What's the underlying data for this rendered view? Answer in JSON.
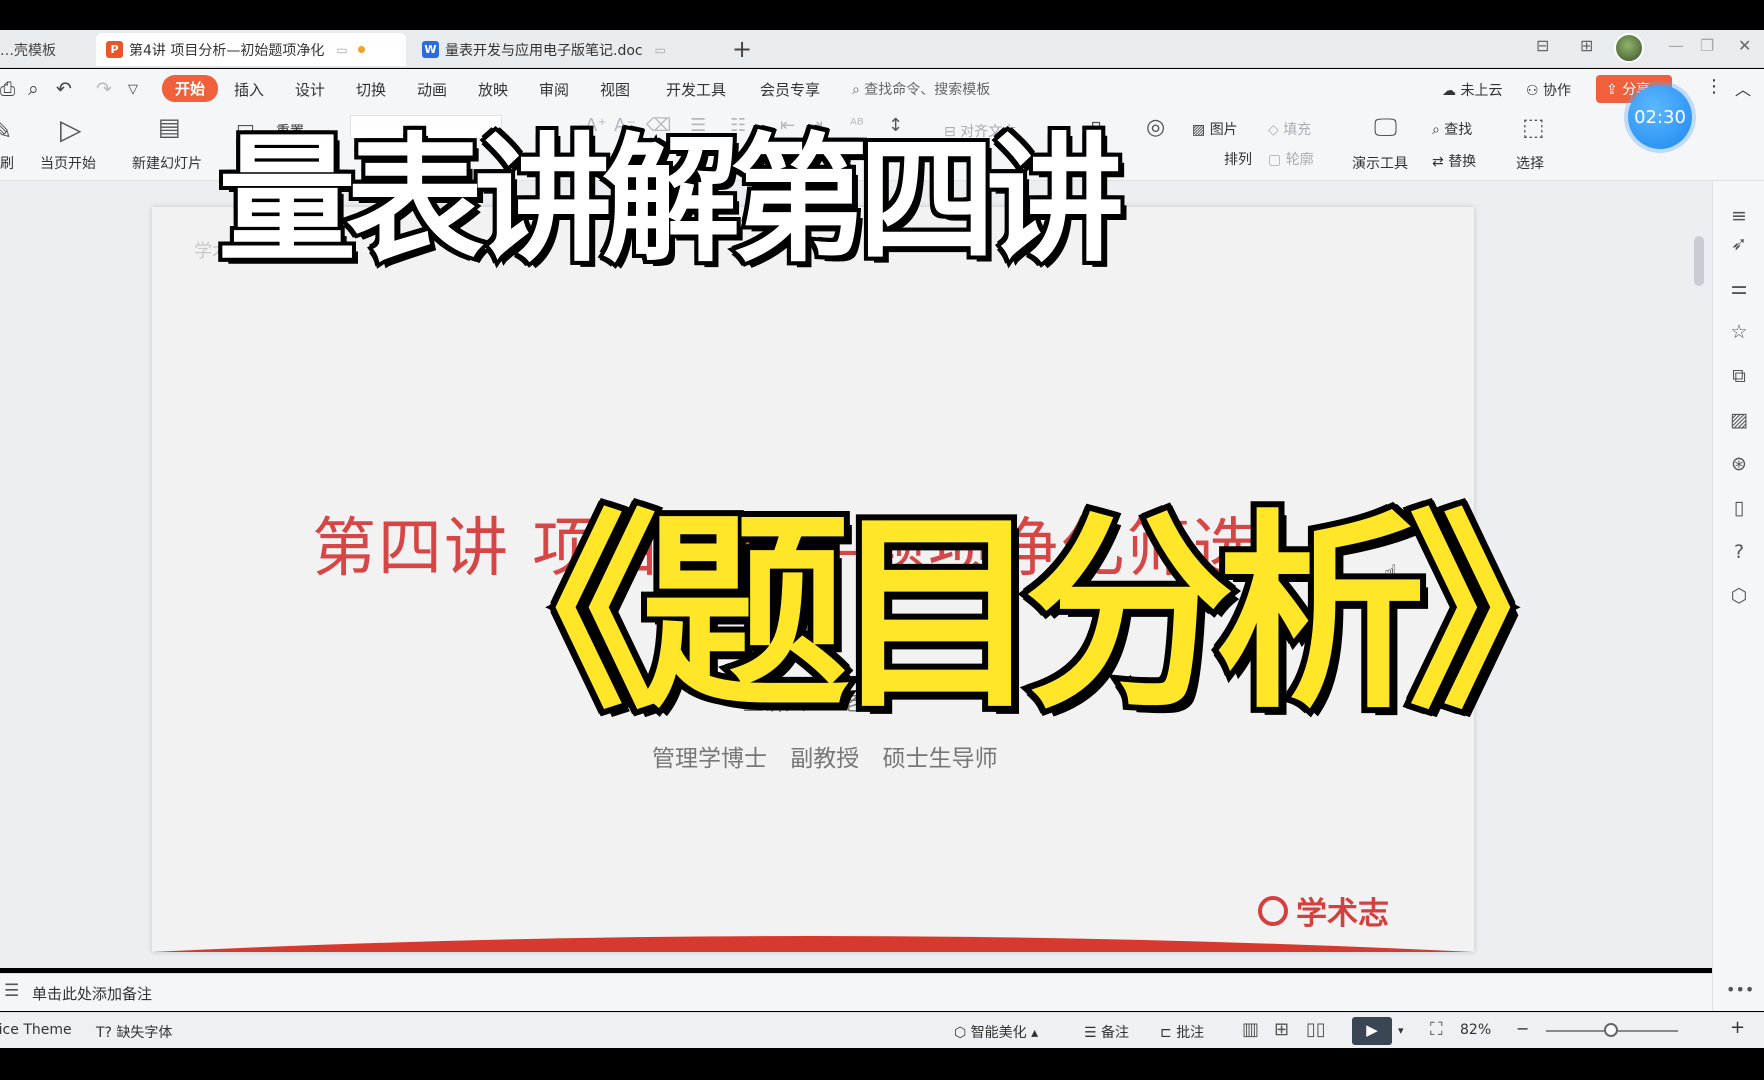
{
  "tabs": [
    {
      "label": "…壳模板",
      "icon": "",
      "active": false
    },
    {
      "label": "第4讲 项目分析—初始题项净化",
      "icon": "P",
      "icon_color": "#e8562a",
      "active": true,
      "unsaved": true
    },
    {
      "label": "量表开发与应用电子版笔记.doc",
      "icon": "W",
      "icon_color": "#2b6de0",
      "active": false
    }
  ],
  "menu": {
    "items": [
      "开始",
      "插入",
      "设计",
      "切换",
      "动画",
      "放映",
      "审阅",
      "视图",
      "开发工具",
      "会员专享"
    ],
    "active": "开始",
    "search_placeholder": "查找命令、搜索模板",
    "cloud_status": "未上云",
    "collab": "协作",
    "share": "分享"
  },
  "timer": "02:30",
  "ribbon": {
    "play_from_current": "当页开始",
    "new_slide": "新建幻灯片",
    "reset": "重置",
    "brush": "刷",
    "align_text": "对齐文本",
    "picture": "图片",
    "fill": "填充",
    "arrange": "排列",
    "outline": "轮廓",
    "present_tools": "演示工具",
    "find": "查找",
    "replace": "替换",
    "select": "选择"
  },
  "slide": {
    "watermark": "学术志",
    "title": "第四讲 项目分析—题项净化筛选",
    "presenter": "主讲人：X老师",
    "subtitle": "管理学博士 副教授 硕士生导师",
    "logo": "学术志"
  },
  "notes_placeholder": "单击此处添加备注",
  "status": {
    "theme": "Office Theme",
    "missing_fonts": "缺失字体",
    "smart_beautify": "智能美化",
    "notes": "备注",
    "comments": "批注",
    "zoom": "82%"
  },
  "overlay": {
    "top": "量表讲解第四讲",
    "main": "《题目分析》"
  },
  "colors": {
    "accent": "#f0603c",
    "slide_title": "#d74646",
    "overlay_main": "#ffe629",
    "timer": "#1e88f0"
  }
}
